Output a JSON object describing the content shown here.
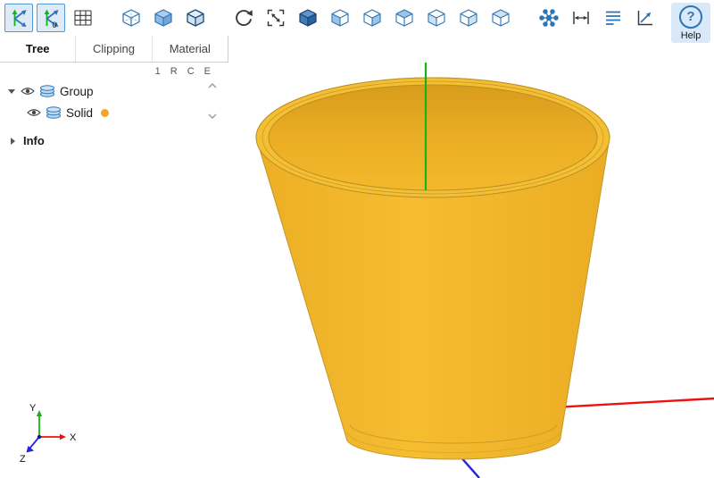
{
  "toolbar": {
    "origin_badge": "0",
    "buttons": [
      {
        "name": "toggle-view-trihedron",
        "selected": true
      },
      {
        "name": "toggle-origin-trihedron",
        "selected": true
      },
      {
        "name": "toggle-grid",
        "selected": false
      },
      {
        "name": "display-wireframe",
        "selected": false
      },
      {
        "name": "display-shaded",
        "selected": false
      },
      {
        "name": "display-shaded-edges",
        "selected": false
      },
      {
        "name": "reset-rotation",
        "selected": false
      },
      {
        "name": "fit-all",
        "selected": false
      },
      {
        "name": "view-isometric",
        "selected": false
      },
      {
        "name": "view-front",
        "selected": false
      },
      {
        "name": "view-back",
        "selected": false
      },
      {
        "name": "view-top",
        "selected": false
      },
      {
        "name": "view-left",
        "selected": false
      },
      {
        "name": "view-right",
        "selected": false
      },
      {
        "name": "view-bottom",
        "selected": false
      },
      {
        "name": "show-vertices",
        "selected": false
      },
      {
        "name": "measure-distance",
        "selected": false
      },
      {
        "name": "show-structure",
        "selected": false
      },
      {
        "name": "pick-mode",
        "selected": false
      }
    ],
    "help": {
      "icon_glyph": "?",
      "label": "Help"
    }
  },
  "sidebar": {
    "tabs": [
      {
        "label": "Tree",
        "active": true
      },
      {
        "label": "Clipping",
        "active": false
      },
      {
        "label": "Material",
        "active": false
      }
    ],
    "column_headers": [
      "1",
      "R",
      "C",
      "E"
    ],
    "tree_items": [
      {
        "label": "Group",
        "level": 0,
        "expanded": true,
        "visible": true
      },
      {
        "label": "Solid",
        "level": 1,
        "visible": true,
        "swatch_color": "#F5A623"
      }
    ],
    "info_label": "Info"
  },
  "viewport": {
    "model": {
      "name": "truncated-cone-solid",
      "color": "#F3B82C"
    },
    "axis_triad": {
      "x_label": "X",
      "y_label": "Y",
      "z_label": "Z"
    },
    "axis_colors": {
      "x": "#EE1111",
      "y": "#15B415",
      "z": "#2323D8"
    }
  }
}
